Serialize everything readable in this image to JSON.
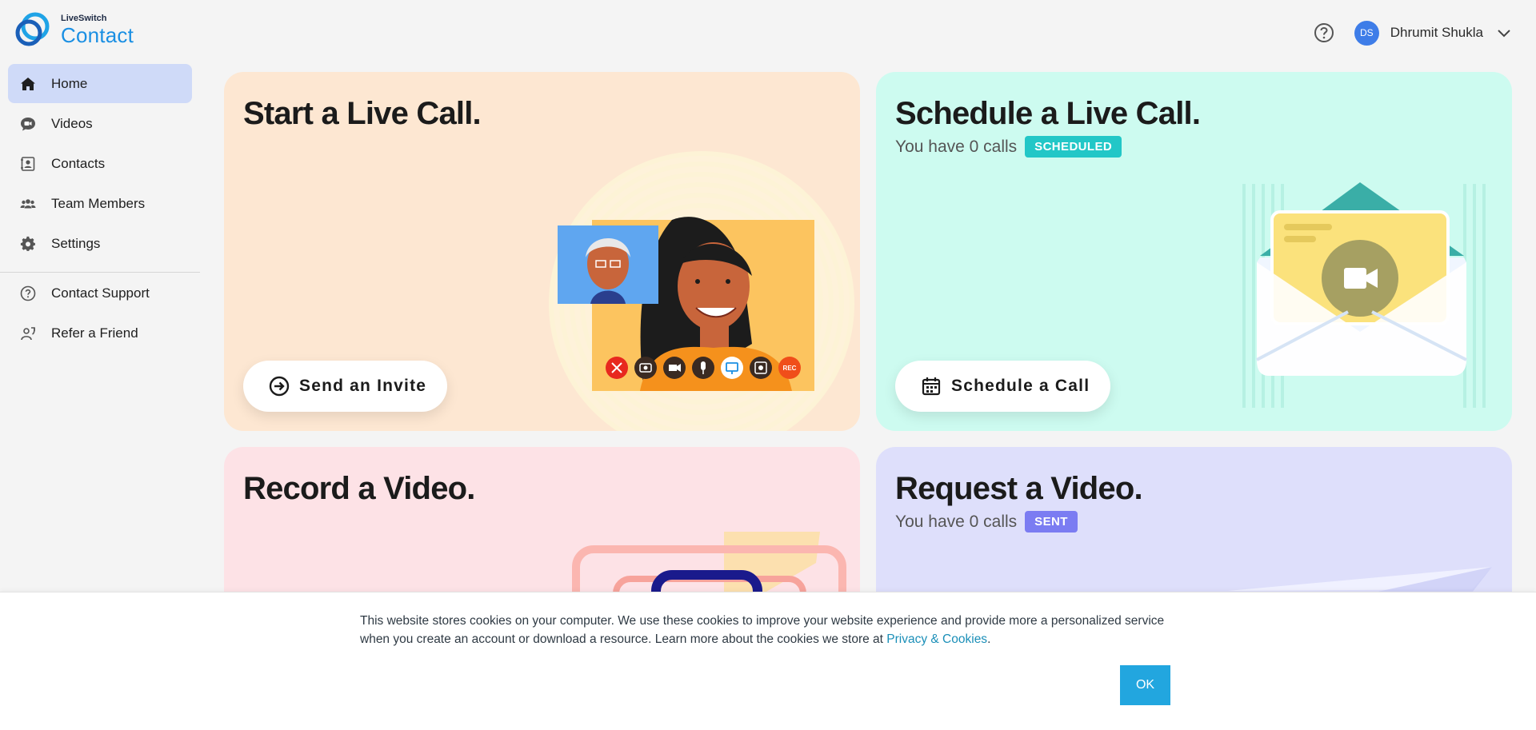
{
  "brand": {
    "small": "LiveSwitch",
    "big": "Contact"
  },
  "sidebar": {
    "items": [
      {
        "label": "Home",
        "icon": "home-icon",
        "active": true
      },
      {
        "label": "Videos",
        "icon": "video-chat-icon",
        "active": false
      },
      {
        "label": "Contacts",
        "icon": "contacts-icon",
        "active": false
      },
      {
        "label": "Team Members",
        "icon": "team-icon",
        "active": false
      },
      {
        "label": "Settings",
        "icon": "gear-icon",
        "active": false
      }
    ],
    "secondary": [
      {
        "label": "Contact Support",
        "icon": "help-circle-icon"
      },
      {
        "label": "Refer a Friend",
        "icon": "refer-icon"
      }
    ]
  },
  "header": {
    "avatar_initials": "DS",
    "user_name": "Dhrumit Shukla"
  },
  "cards": {
    "live_call": {
      "title": "Start a Live Call.",
      "button": "Send an Invite",
      "color": "#fde7d2"
    },
    "schedule": {
      "title": "Schedule a Live Call.",
      "sub": "You have 0 calls",
      "badge": "SCHEDULED",
      "badge_color": "#22c7c7",
      "button": "Schedule a Call",
      "color": "#cdfbf0"
    },
    "record": {
      "title": "Record a Video.",
      "color": "#fde2e6"
    },
    "request": {
      "title": "Request a Video.",
      "sub": "You have 0 calls",
      "badge": "SENT",
      "badge_color": "#7b7cf2",
      "color": "#dedffb"
    }
  },
  "call_controls": {
    "rec_label": "REC"
  },
  "cookie": {
    "text": "This website stores cookies on your computer. We use these cookies to improve your website experience and provide more a personalized service when you create an account or download a resource. Learn more about the cookies we store at",
    "link": "Privacy & Cookies",
    "end": ".",
    "ok": "OK"
  }
}
